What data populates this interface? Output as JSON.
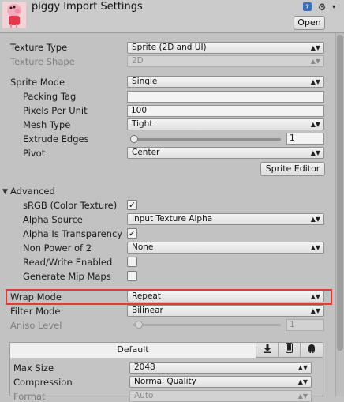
{
  "header": {
    "title": "piggy Import Settings",
    "open_label": "Open",
    "icons": [
      "book-help-icon",
      "gear-icon"
    ]
  },
  "fields": {
    "texture_type": {
      "label": "Texture Type",
      "value": "Sprite (2D and UI)"
    },
    "texture_shape": {
      "label": "Texture Shape",
      "value": "2D"
    },
    "sprite_mode": {
      "label": "Sprite Mode",
      "value": "Single"
    },
    "packing_tag": {
      "label": "Packing Tag",
      "value": ""
    },
    "pixels_per_unit": {
      "label": "Pixels Per Unit",
      "value": "100"
    },
    "mesh_type": {
      "label": "Mesh Type",
      "value": "Tight"
    },
    "extrude_edges": {
      "label": "Extrude Edges",
      "value": "1"
    },
    "pivot": {
      "label": "Pivot",
      "value": "Center"
    },
    "sprite_editor_label": "Sprite Editor"
  },
  "advanced": {
    "label": "Advanced",
    "srgb": {
      "label": "sRGB (Color Texture)",
      "checked": true
    },
    "alpha_source": {
      "label": "Alpha Source",
      "value": "Input Texture Alpha"
    },
    "alpha_is_transparency": {
      "label": "Alpha Is Transparency",
      "checked": true
    },
    "non_power_of_2": {
      "label": "Non Power of 2",
      "value": "None"
    },
    "read_write": {
      "label": "Read/Write Enabled",
      "checked": false
    },
    "mip_maps": {
      "label": "Generate Mip Maps",
      "checked": false
    }
  },
  "wrap_mode": {
    "label": "Wrap Mode",
    "value": "Repeat"
  },
  "filter_mode": {
    "label": "Filter Mode",
    "value": "Bilinear"
  },
  "aniso_level": {
    "label": "Aniso Level",
    "value": "1"
  },
  "platform": {
    "tab_default": "Default",
    "tab_icons": [
      "download-icon",
      "phone-icon",
      "android-icon"
    ],
    "max_size": {
      "label": "Max Size",
      "value": "2048"
    },
    "compression": {
      "label": "Compression",
      "value": "Normal Quality"
    },
    "format": {
      "label": "Format",
      "value": "Auto"
    }
  },
  "dropdown_arrow": "▲▼",
  "check_mark": "✓",
  "foldout_open": "▼",
  "colors": {
    "highlight": "#e53935"
  }
}
